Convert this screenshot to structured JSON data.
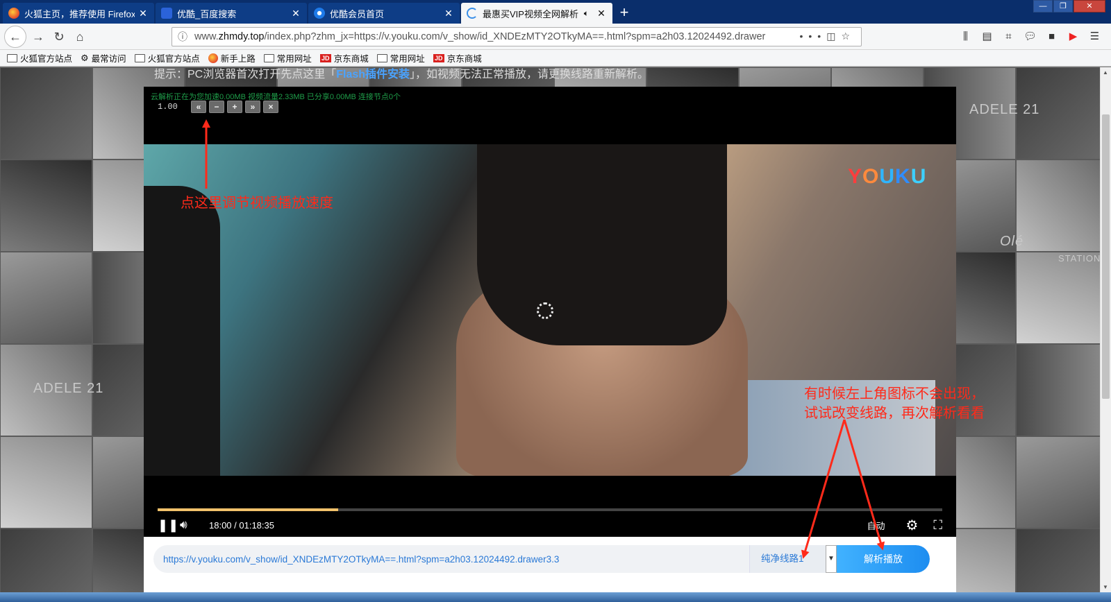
{
  "tabs": [
    {
      "title": "火狐主页，推荐使用 Firefox 火",
      "color": "#e5582c"
    },
    {
      "title": "优酷_百度搜索",
      "color": "#2b63d9"
    },
    {
      "title": "优酷会员首页",
      "color": "#1e7ae8"
    },
    {
      "title": "最惠买VIP视频全网解析",
      "color": "#3a8fe8"
    }
  ],
  "window": {
    "new_tab": "+",
    "minimize": "—",
    "restore": "❐",
    "close": "✕"
  },
  "nav": {
    "url_prefix": "www.",
    "url_domain": "zhmdy.top",
    "url_rest": "/index.php?zhm_jx=https://v.youku.com/v_show/id_XNDEzMTY2OTkyMA==.html?spm=a2h03.12024492.drawer",
    "more": "•••"
  },
  "bookmarks": [
    {
      "label": "火狐官方站点",
      "icon": "folder"
    },
    {
      "label": "最常访问",
      "icon": "gear"
    },
    {
      "label": "火狐官方站点",
      "icon": "folder"
    },
    {
      "label": "新手上路",
      "icon": "ff"
    },
    {
      "label": "常用网址",
      "icon": "folder"
    },
    {
      "label": "京东商城",
      "icon": "jd"
    },
    {
      "label": "常用网址",
      "icon": "folder"
    },
    {
      "label": "京东商城",
      "icon": "jd"
    }
  ],
  "page": {
    "hint_prefix": "提示：PC浏览器首次打开先点这里「",
    "hint_link": "Flash插件安装",
    "hint_suffix": "」，如视频无法正常播放，请更换线路重新解析。"
  },
  "player": {
    "stat_line": "云解析正在为您加速0.00MB 视频流量2.33MB 已分享0.00MB 连接节点0个",
    "speed": "1.00",
    "speed_buttons": [
      "«",
      "−",
      "+",
      "»",
      "×"
    ],
    "logo": [
      "Y",
      "O",
      "U",
      "K",
      "U"
    ],
    "time": "18:00 / 01:18:35",
    "progress": 0.23,
    "quality": "自动"
  },
  "parse": {
    "url": "https://v.youku.com/v_show/id_XNDEzMTY2OTkyMA==.html?spm=a2h03.12024492.drawer3.3",
    "line": "纯净线路1",
    "button": "解析播放"
  },
  "annotations": {
    "speed_tip": "点这里调节视频播放速度",
    "route_tip_1": "有时候左上角图标不会出现，",
    "route_tip_2": "试试改变线路，再次解析看看",
    "color": "#ff2a1a"
  },
  "background_labels": [
    "ADELE 21",
    "ADELE 21",
    "Olé",
    "STATION"
  ]
}
